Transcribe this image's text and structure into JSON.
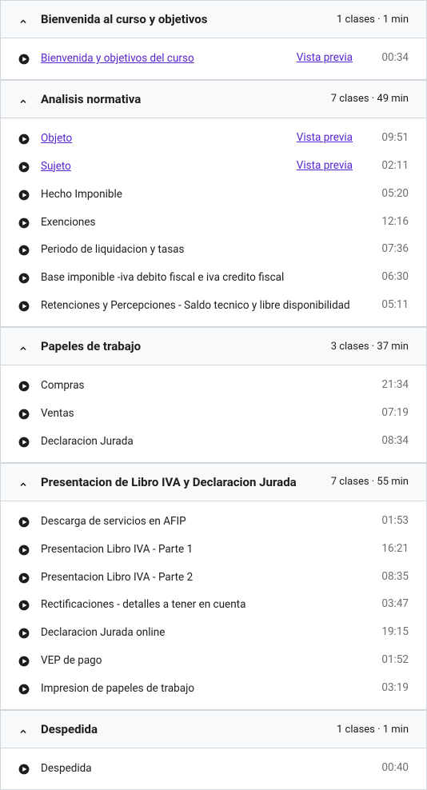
{
  "previewLabel": "Vista previa",
  "sections": [
    {
      "title": "Bienvenida al curso y objetivos",
      "meta": "1 clases · 1 min",
      "lessons": [
        {
          "title": "Bienvenida y objetivos del curso",
          "preview": true,
          "duration": "00:34"
        }
      ]
    },
    {
      "title": "Analisis normativa",
      "meta": "7 clases · 49 min",
      "lessons": [
        {
          "title": "Objeto",
          "preview": true,
          "duration": "09:51"
        },
        {
          "title": "Sujeto",
          "preview": true,
          "duration": "02:11"
        },
        {
          "title": "Hecho Imponible",
          "preview": false,
          "duration": "05:20"
        },
        {
          "title": "Exenciones",
          "preview": false,
          "duration": "12:16"
        },
        {
          "title": "Periodo de liquidacion y tasas",
          "preview": false,
          "duration": "07:36"
        },
        {
          "title": "Base imponible -iva debito fiscal e iva credito fiscal",
          "preview": false,
          "duration": "06:30"
        },
        {
          "title": "Retenciones y Percepciones - Saldo tecnico y libre disponibilidad",
          "preview": false,
          "duration": "05:11"
        }
      ]
    },
    {
      "title": "Papeles de trabajo",
      "meta": "3 clases · 37 min",
      "lessons": [
        {
          "title": "Compras",
          "preview": false,
          "duration": "21:34"
        },
        {
          "title": "Ventas",
          "preview": false,
          "duration": "07:19"
        },
        {
          "title": "Declaracion Jurada",
          "preview": false,
          "duration": "08:34"
        }
      ]
    },
    {
      "title": "Presentacion de Libro IVA y Declaracion Jurada",
      "meta": "7 clases · 55 min",
      "lessons": [
        {
          "title": "Descarga de servicios en AFIP",
          "preview": false,
          "duration": "01:53"
        },
        {
          "title": "Presentacion Libro IVA - Parte 1",
          "preview": false,
          "duration": "16:21"
        },
        {
          "title": "Presentacion Libro IVA - Parte 2",
          "preview": false,
          "duration": "08:35"
        },
        {
          "title": "Rectificaciones - detalles a tener en cuenta",
          "preview": false,
          "duration": "03:47"
        },
        {
          "title": "Declaracion Jurada online",
          "preview": false,
          "duration": "19:15"
        },
        {
          "title": "VEP de pago",
          "preview": false,
          "duration": "01:52"
        },
        {
          "title": "Impresion de papeles de trabajo",
          "preview": false,
          "duration": "03:19"
        }
      ]
    },
    {
      "title": "Despedida",
      "meta": "1 clases · 1 min",
      "lessons": [
        {
          "title": "Despedida",
          "preview": false,
          "duration": "00:40"
        }
      ]
    }
  ]
}
